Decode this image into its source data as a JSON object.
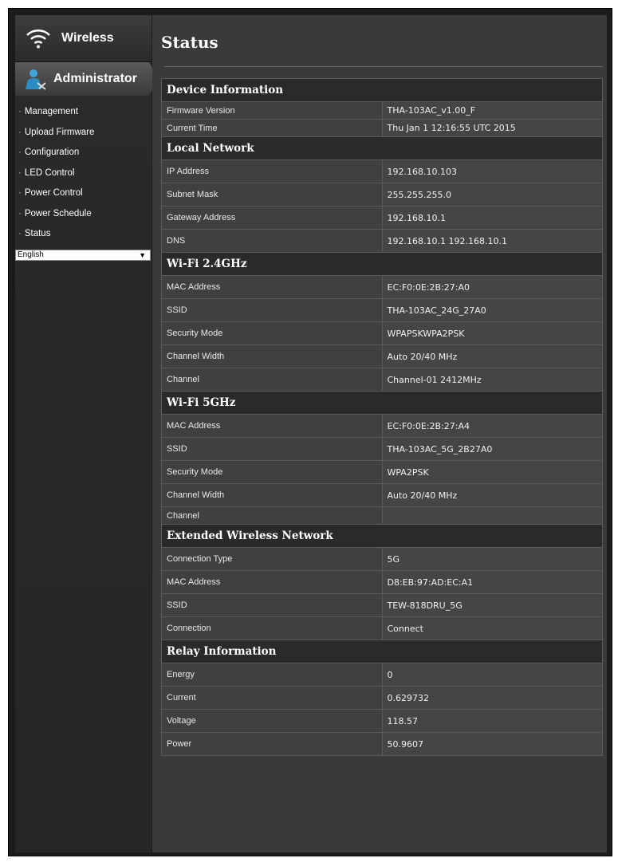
{
  "sidebar": {
    "wireless_label": "Wireless",
    "admin_label": "Administrator",
    "menu": [
      "Management",
      "Upload Firmware",
      "Configuration",
      "LED Control",
      "Power Control",
      "Power Schedule",
      "Status"
    ],
    "language": "English"
  },
  "page_title": "Status",
  "sections": {
    "device": {
      "title": "Device Information",
      "rows": [
        {
          "label": "Firmware Version",
          "value": "THA-103AC_v1.00_F"
        },
        {
          "label": "Current Time",
          "value": "Thu Jan 1 12:16:55 UTC 2015"
        }
      ]
    },
    "local": {
      "title": "Local Network",
      "rows": [
        {
          "label": "IP Address",
          "value": "192.168.10.103"
        },
        {
          "label": "Subnet Mask",
          "value": "255.255.255.0"
        },
        {
          "label": "Gateway Address",
          "value": "192.168.10.1"
        },
        {
          "label": "DNS",
          "value": "192.168.10.1 192.168.10.1"
        }
      ]
    },
    "wifi24": {
      "title": "Wi-Fi 2.4GHz",
      "rows": [
        {
          "label": "MAC Address",
          "value": "EC:F0:0E:2B:27:A0"
        },
        {
          "label": "SSID",
          "value": "THA-103AC_24G_27A0"
        },
        {
          "label": "Security Mode",
          "value": "WPAPSKWPA2PSK"
        },
        {
          "label": "Channel Width",
          "value": "Auto 20/40 MHz"
        },
        {
          "label": "Channel",
          "value": "Channel-01 2412MHz"
        }
      ]
    },
    "wifi5": {
      "title": "Wi-Fi 5GHz",
      "rows": [
        {
          "label": "MAC Address",
          "value": "EC:F0:0E:2B:27:A4"
        },
        {
          "label": "SSID",
          "value": "THA-103AC_5G_2B27A0"
        },
        {
          "label": "Security Mode",
          "value": "WPA2PSK"
        },
        {
          "label": "Channel Width",
          "value": "Auto 20/40 MHz"
        },
        {
          "label": "Channel",
          "value": ""
        }
      ]
    },
    "extended": {
      "title": "Extended Wireless Network",
      "rows": [
        {
          "label": "Connection Type",
          "value": "5G"
        },
        {
          "label": "MAC Address",
          "value": "D8:EB:97:AD:EC:A1"
        },
        {
          "label": "SSID",
          "value": "TEW-818DRU_5G"
        },
        {
          "label": "Connection",
          "value": "Connect"
        }
      ]
    },
    "relay": {
      "title": "Relay Information",
      "rows": [
        {
          "label": "Energy",
          "value": "0"
        },
        {
          "label": "Current",
          "value": "0.629732"
        },
        {
          "label": "Voltage",
          "value": "118.57"
        },
        {
          "label": "Power",
          "value": "50.9607"
        }
      ]
    }
  },
  "colors": {
    "background": "#3a3a3a",
    "sidebar": "#262626",
    "text": "#ffffff"
  }
}
